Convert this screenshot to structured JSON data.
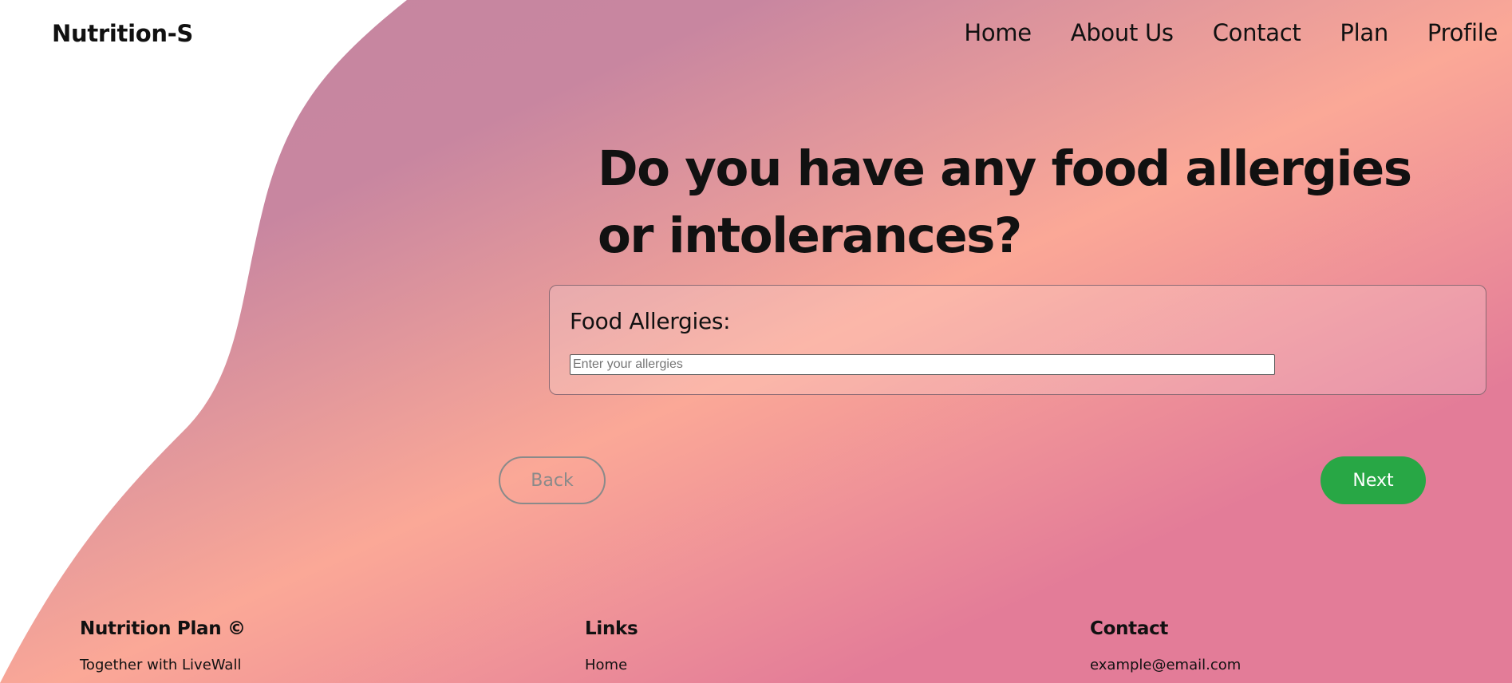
{
  "header": {
    "logo": "Nutrition-S",
    "nav": [
      "Home",
      "About Us",
      "Contact",
      "Plan",
      "Profile"
    ]
  },
  "question": {
    "title": "Do you have any food allergies or intolerances?"
  },
  "form": {
    "label": "Food Allergies:",
    "input_value": "",
    "input_placeholder": "Enter your allergies"
  },
  "buttons": {
    "back": "Back",
    "next": "Next"
  },
  "footer": {
    "brand_title": "Nutrition Plan ©",
    "brand_text": "Together with LiveWall",
    "links_title": "Links",
    "links": [
      "Home"
    ],
    "contact_title": "Contact",
    "contact_email": "example@email.com"
  },
  "colors": {
    "gradient_start": "#c585a0",
    "gradient_mid": "#fba897",
    "gradient_end": "#e37c98",
    "next_button": "#28a745",
    "back_button_border": "#8a8a8a"
  }
}
